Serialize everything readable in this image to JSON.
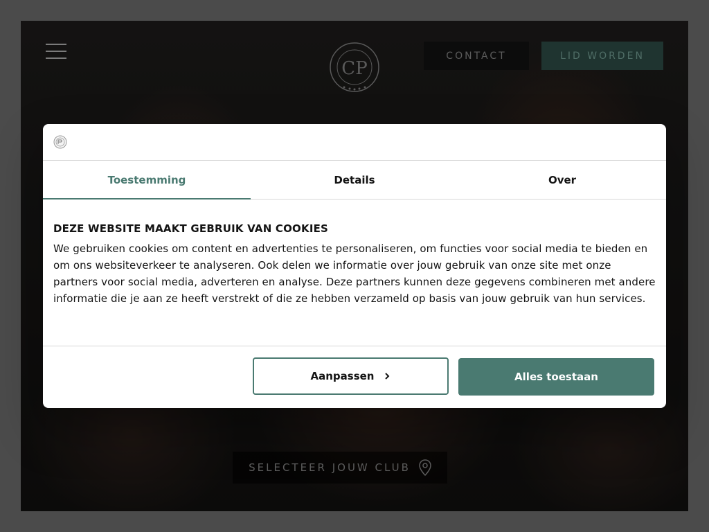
{
  "header": {
    "contact_label": "CONTACT",
    "join_label": "LID WORDEN",
    "logo_text": "CP"
  },
  "club_select": {
    "label": "SELECTEER JOUW CLUB"
  },
  "cookie_dialog": {
    "tabs": [
      {
        "label": "Toestemming",
        "active": true
      },
      {
        "label": "Details",
        "active": false
      },
      {
        "label": "Over",
        "active": false
      }
    ],
    "heading": "DEZE WEBSITE MAAKT GEBRUIK VAN COOKIES",
    "body": "We gebruiken cookies om content en advertenties te personaliseren, om functies voor social media te bieden en om ons websiteverkeer te analyseren. Ook delen we informatie over jouw gebruik van onze site met onze partners voor social media, adverteren en analyse. Deze partners kunnen deze gegevens combineren met andere informatie die je aan ze heeft verstrekt of die ze hebben verzameld op basis van jouw gebruik van hun services.",
    "customize_label": "Aanpassen",
    "allow_all_label": "Alles toestaan"
  },
  "colors": {
    "accent": "#4a7a71",
    "backdrop": "#4b4b4b"
  }
}
